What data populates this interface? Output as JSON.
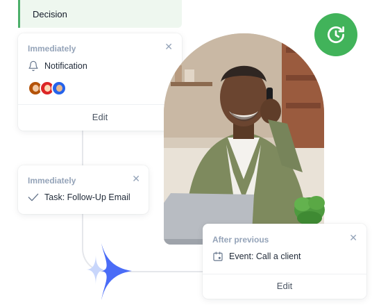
{
  "decision": {
    "label": "Decision"
  },
  "card1": {
    "timing": "Immediately",
    "action": "Notification",
    "action_icon": "bell-icon",
    "close_icon": "close-icon",
    "edit_label": "Edit",
    "avatars": [
      "avatar-user-1",
      "avatar-user-2",
      "avatar-user-3"
    ]
  },
  "card2": {
    "timing": "Immediately",
    "action": "Task: Follow-Up Email",
    "action_icon": "check-icon",
    "close_icon": "close-icon"
  },
  "card3": {
    "timing": "After previous",
    "action": "Event: Call a client",
    "action_icon": "calendar-icon",
    "close_icon": "close-icon",
    "edit_label": "Edit"
  },
  "refresh_button": {
    "icon": "refresh-clock-icon",
    "color": "#41b35a"
  },
  "colors": {
    "accent_green": "#41b35a",
    "accent_blue": "#4a6cf7",
    "muted": "#94a3b8"
  }
}
